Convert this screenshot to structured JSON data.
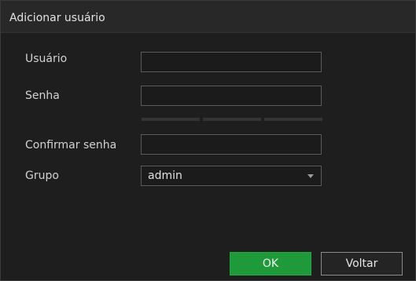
{
  "dialog": {
    "title": "Adicionar usuário"
  },
  "form": {
    "user_label": "Usuário",
    "user_value": "",
    "password_label": "Senha",
    "password_value": "",
    "confirm_label": "Confirmar senha",
    "confirm_value": "",
    "group_label": "Grupo",
    "group_value": "admin"
  },
  "buttons": {
    "ok_label": "OK",
    "back_label": "Voltar"
  },
  "colors": {
    "accent_ok": "#1f9a3b",
    "background": "#1e1e1e"
  }
}
